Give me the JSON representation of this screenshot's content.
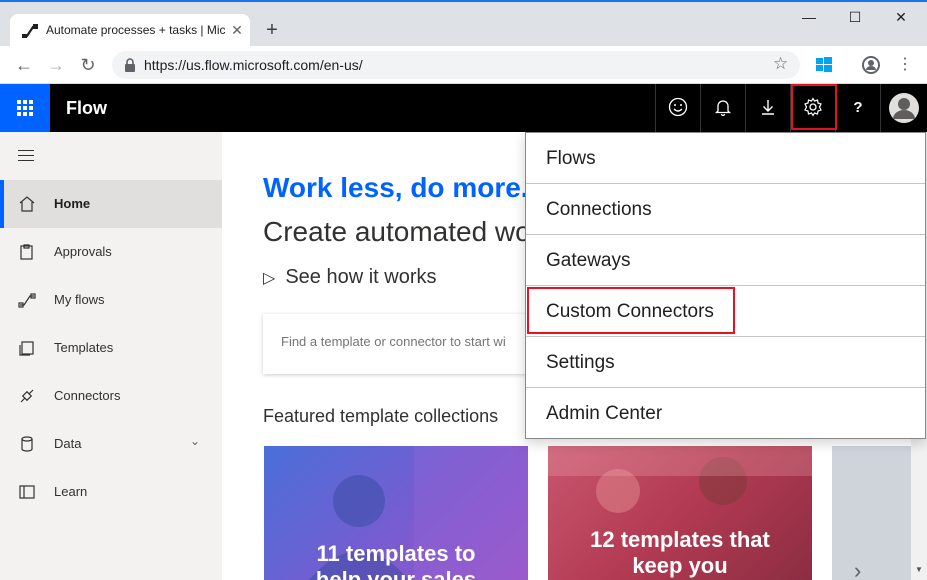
{
  "browser": {
    "tab_title": "Automate processes + tasks | Mic",
    "url": "https://us.flow.microsoft.com/en-us/"
  },
  "appbar": {
    "brand": "Flow",
    "icons": [
      "feedback-smiley-icon",
      "notifications-bell-icon",
      "download-icon",
      "settings-gear-icon",
      "help-icon",
      "user-avatar-icon"
    ],
    "help_label": "?"
  },
  "sidebar": {
    "items": [
      {
        "label": "Home",
        "icon": "home-icon",
        "active": true
      },
      {
        "label": "Approvals",
        "icon": "approvals-icon"
      },
      {
        "label": "My flows",
        "icon": "my-flows-icon"
      },
      {
        "label": "Templates",
        "icon": "templates-icon"
      },
      {
        "label": "Connectors",
        "icon": "connectors-icon"
      },
      {
        "label": "Data",
        "icon": "data-icon",
        "expandable": true
      },
      {
        "label": "Learn",
        "icon": "learn-icon"
      }
    ]
  },
  "main": {
    "hero_title": "Work less, do more.",
    "hero_subtitle": "Create automated wor",
    "see_how": "See how it works",
    "search_placeholder": "Find a template or connector to start wi",
    "featured_heading": "Featured template collections",
    "cards": [
      {
        "line1": "11 templates to",
        "line2": "help your sales"
      },
      {
        "line1": "12 templates that",
        "line2": "keep you"
      }
    ]
  },
  "settings_menu": {
    "items": [
      "Flows",
      "Connections",
      "Gateways",
      "Custom Connectors",
      "Settings",
      "Admin Center"
    ],
    "highlighted": "Custom Connectors"
  },
  "colors": {
    "accent": "#0062ff",
    "appbar": "#000000",
    "highlight": "#e81123"
  }
}
